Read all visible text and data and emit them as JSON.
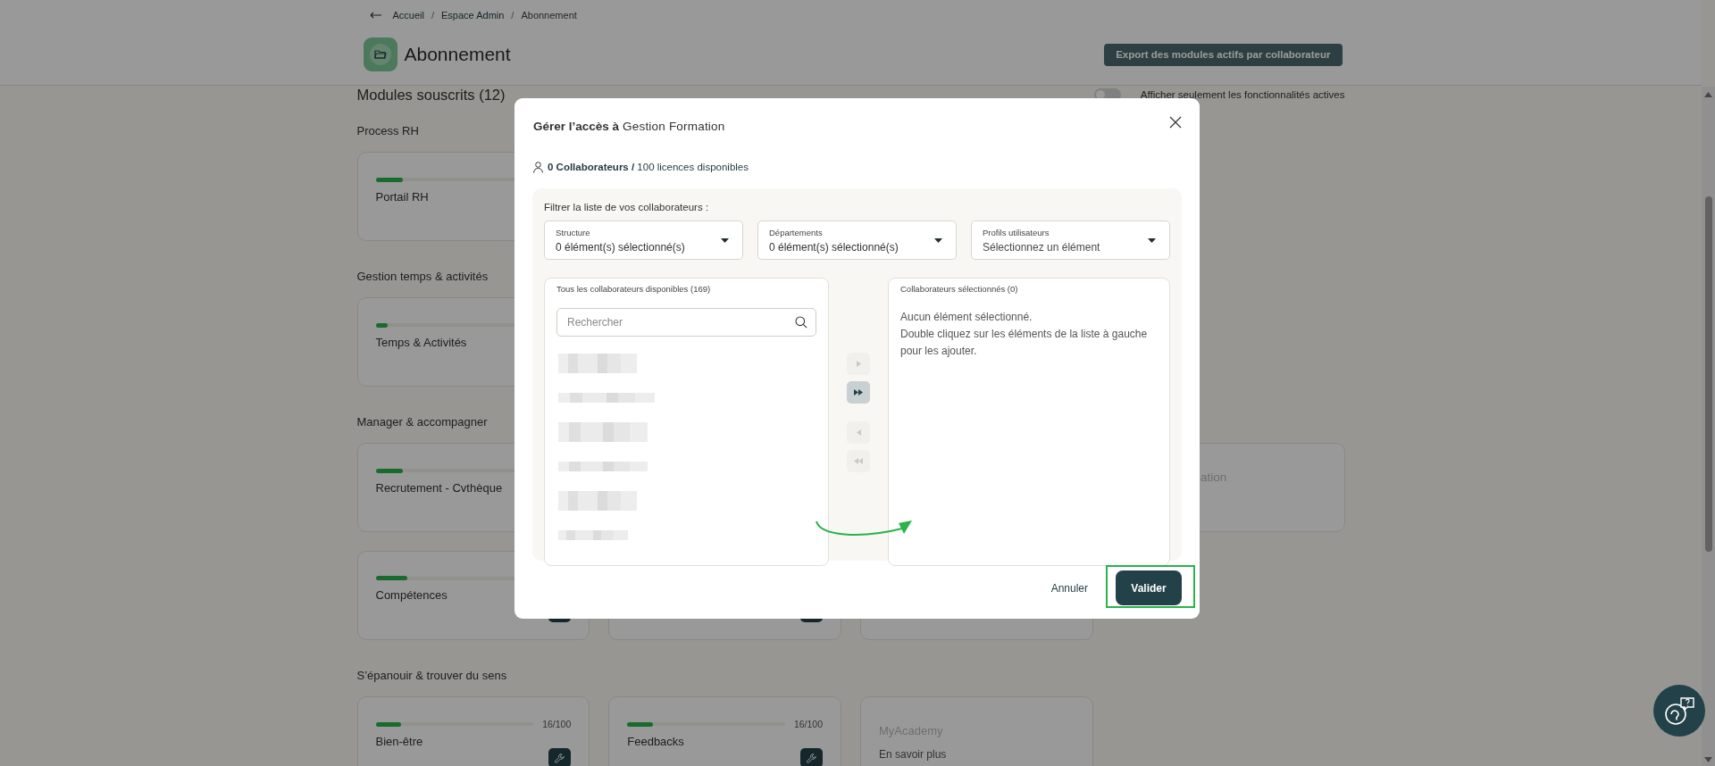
{
  "header": {
    "breadcrumb": [
      {
        "kind": "link",
        "label": "Accueil"
      },
      {
        "kind": "separator",
        "label": "/"
      },
      {
        "kind": "link",
        "label": "Espace Admin"
      },
      {
        "kind": "separator",
        "label": "/"
      },
      {
        "kind": "current",
        "label": "Abonnement"
      }
    ],
    "title": "Abonnement",
    "export_button": "Export des modules actifs par collaborateur"
  },
  "modules": {
    "heading": "Modules souscrits (12)",
    "toggle": {
      "label": "Afficher seulement les fonctionnalités actives",
      "on": false
    },
    "sections": [
      {
        "title": "Process RH",
        "cards": [
          {
            "kind": "module",
            "title": "Portail RH",
            "level": 0.14,
            "configurable": false,
            "disabled": false
          }
        ]
      },
      {
        "title": "Gestion temps & activités",
        "cards": [
          {
            "kind": "module",
            "title": "Temps & Activités",
            "level": 0.06,
            "configurable": false,
            "disabled": false
          }
        ]
      },
      {
        "title": "Manager & accompagner",
        "cards": [
          {
            "kind": "module",
            "title": "Recrutement - Cvthèque",
            "level": 0.14,
            "configurable": false,
            "disabled": false
          },
          {
            "kind": "spacer"
          },
          {
            "kind": "clipped",
            "title": "ation",
            "disabled": true
          },
          {
            "kind": "module",
            "title": "Compétences",
            "level": 0.16,
            "configurable": true,
            "disabled": false
          },
          {
            "kind": "stub",
            "configurable": true
          },
          {
            "kind": "stub",
            "configurable": false
          }
        ]
      },
      {
        "title": "S’épanouir & trouver du sens",
        "cards": [
          {
            "kind": "module",
            "title": "Bien-être",
            "level": 0.16,
            "count": "16/100",
            "configurable": true,
            "disabled": false
          },
          {
            "kind": "module",
            "title": "Feedbacks",
            "level": 0.16,
            "count": "16/100",
            "configurable": true,
            "disabled": false
          },
          {
            "kind": "module",
            "title": "MyAcademy",
            "link": "En savoir plus",
            "configurable": false,
            "disabled": true
          }
        ]
      }
    ]
  },
  "dialog": {
    "title": "**Gérer l’accès à** Gestion Formation",
    "summary": "**0 Collaborateurs /** 100 licences disponibles",
    "filter_label": "Filtrer la liste de vos collaborateurs :",
    "filters": [
      {
        "label": "Structure",
        "value": "0 élément(s) sélectionné(s)"
      },
      {
        "label": "Départements",
        "value": "0 élément(s) sélectionné(s)"
      },
      {
        "label": "Profils utilisateurs",
        "placeholder": "Sélectionnez un élément"
      }
    ],
    "available": {
      "title": "Tous les collaborateurs disponibles (169)",
      "search": {
        "placeholder": "Rechercher"
      },
      "rows": [
        {
          "kind": "double"
        },
        {
          "kind": "single"
        },
        {
          "kind": "double"
        },
        {
          "kind": "single"
        },
        {
          "kind": "double"
        },
        {
          "kind": "single"
        }
      ]
    },
    "transfer_buttons": [
      {
        "kind": "one-right",
        "disabled": true
      },
      {
        "kind": "all-right",
        "disabled": false
      },
      {
        "kind": "one-left",
        "disabled": true
      },
      {
        "kind": "all-left",
        "disabled": true
      }
    ],
    "chosen": {
      "title": "Collaborateurs sélectionnés (0)",
      "empty_lines": [
        "Aucun élément sélectionné.",
        "Double cliquez sur les éléments de la liste à gauche pour les ajouter."
      ]
    },
    "cancel": "Annuler",
    "confirm": "Valider",
    "confirm_highlighted": true
  }
}
